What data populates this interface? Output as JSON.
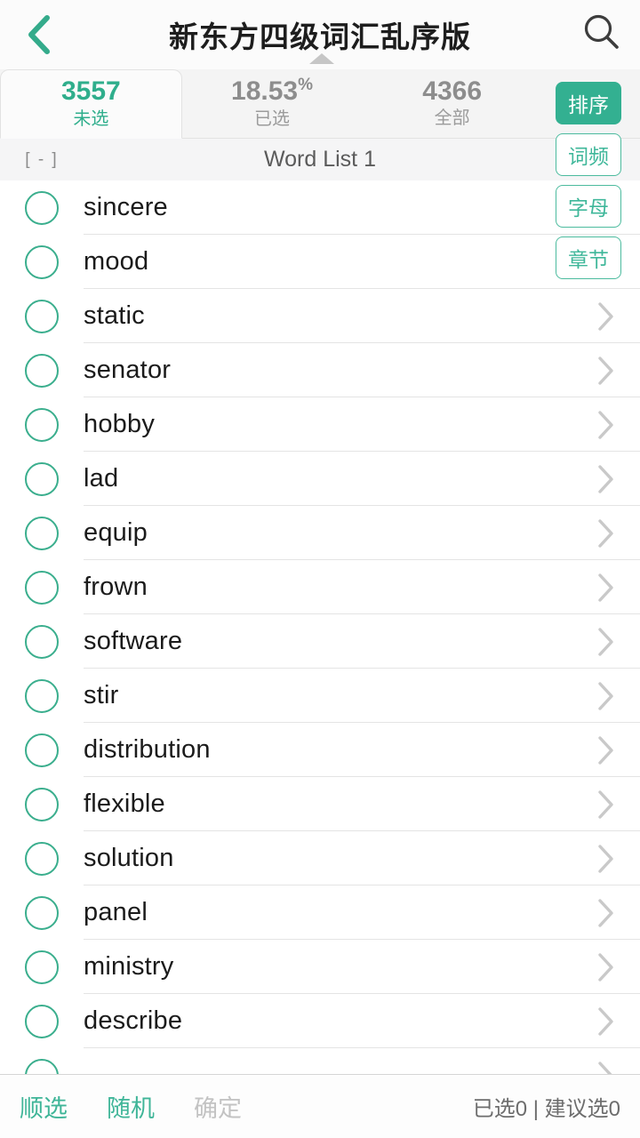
{
  "navbar": {
    "back_icon": "chevron-left-icon",
    "title": "新东方四级词汇乱序版",
    "search_icon": "search-icon",
    "collapse_icon": "caret-up-icon"
  },
  "tabs": [
    {
      "value": "3557",
      "suffix": "",
      "label": "未选",
      "active": true
    },
    {
      "value": "18.53",
      "suffix": "%",
      "label": "已选",
      "active": false
    },
    {
      "value": "4366",
      "suffix": "",
      "label": "全部",
      "active": false
    }
  ],
  "sort_menu": {
    "trigger_label": "排序",
    "options": [
      {
        "label": "词频"
      },
      {
        "label": "字母"
      },
      {
        "label": "章节"
      }
    ]
  },
  "section": {
    "toggle_label": "[ - ]",
    "title": "Word List 1"
  },
  "words": [
    {
      "text": "sincere"
    },
    {
      "text": "mood"
    },
    {
      "text": "static"
    },
    {
      "text": "senator"
    },
    {
      "text": "hobby"
    },
    {
      "text": "lad"
    },
    {
      "text": "equip"
    },
    {
      "text": "frown"
    },
    {
      "text": "software"
    },
    {
      "text": "stir"
    },
    {
      "text": "distribution"
    },
    {
      "text": "flexible"
    },
    {
      "text": "solution"
    },
    {
      "text": "panel"
    },
    {
      "text": "ministry"
    },
    {
      "text": "describe"
    },
    {
      "text": ""
    }
  ],
  "footer": {
    "sequential_label": "顺选",
    "random_label": "随机",
    "confirm_label": "确定",
    "status": "已选0 | 建议选0"
  },
  "colors": {
    "accent": "#33b091",
    "accent_light": "#3fb598",
    "text_primary": "#1b1b1b",
    "text_muted": "#8d8d8d",
    "divider": "#e4e4e4",
    "bar_bg": "#f4f4f4"
  }
}
